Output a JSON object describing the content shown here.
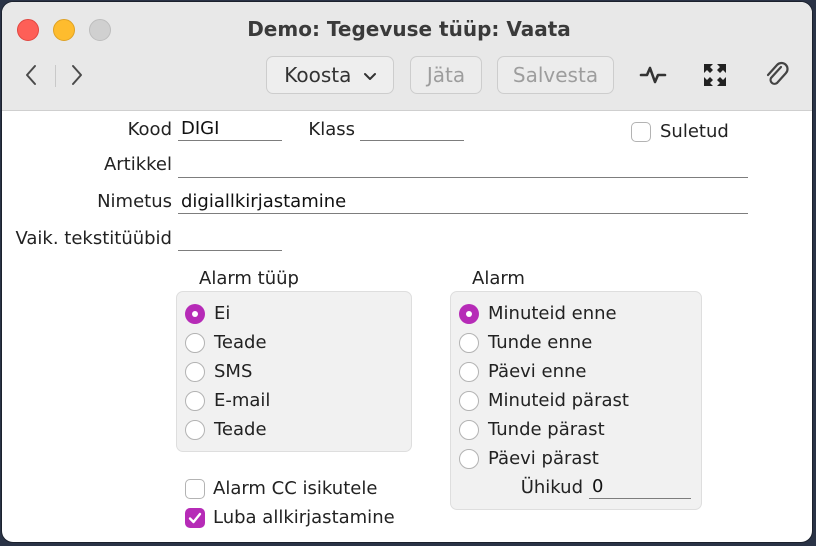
{
  "window": {
    "title": "Demo: Tegevuse tüüp: Vaata"
  },
  "toolbar": {
    "back_glyph": "‹",
    "forward_glyph": "›",
    "koosta_label": "Koosta",
    "jata_label": "Jäta",
    "salvesta_label": "Salvesta",
    "icons": [
      "activity-icon",
      "expand-icon",
      "attachment-icon"
    ]
  },
  "form": {
    "kood_label": "Kood",
    "kood_value": "DIGI",
    "klass_label": "Klass",
    "klass_value": "",
    "suletud_label": "Suletud",
    "suletud_checked": false,
    "artikkel_label": "Artikkel",
    "artikkel_value": "",
    "nimetus_label": "Nimetus",
    "nimetus_value": "digiallkirjastamine",
    "vaik_label": "Vaik. tekstitüübid",
    "vaik_value": ""
  },
  "alarm_type": {
    "label": "Alarm tüüp",
    "selected": 0,
    "options": [
      "Ei",
      "Teade",
      "SMS",
      "E-mail",
      "Teade"
    ]
  },
  "alarm": {
    "label": "Alarm",
    "selected": 0,
    "options": [
      "Minuteid enne",
      "Tunde enne",
      "Päevi enne",
      "Minuteid pärast",
      "Tunde pärast",
      "Päevi pärast"
    ],
    "uhikud_label": "Ühikud",
    "uhikud_value": "0"
  },
  "checkboxes": {
    "alarm_cc_label": "Alarm CC isikutele",
    "alarm_cc_checked": false,
    "luba_label": "Luba allkirjastamine",
    "luba_checked": true
  },
  "colors": {
    "accent": "#b62bb7",
    "close": "#fe5f57",
    "minimize": "#febc2e",
    "zoom_disabled": "#d0d0d0"
  }
}
